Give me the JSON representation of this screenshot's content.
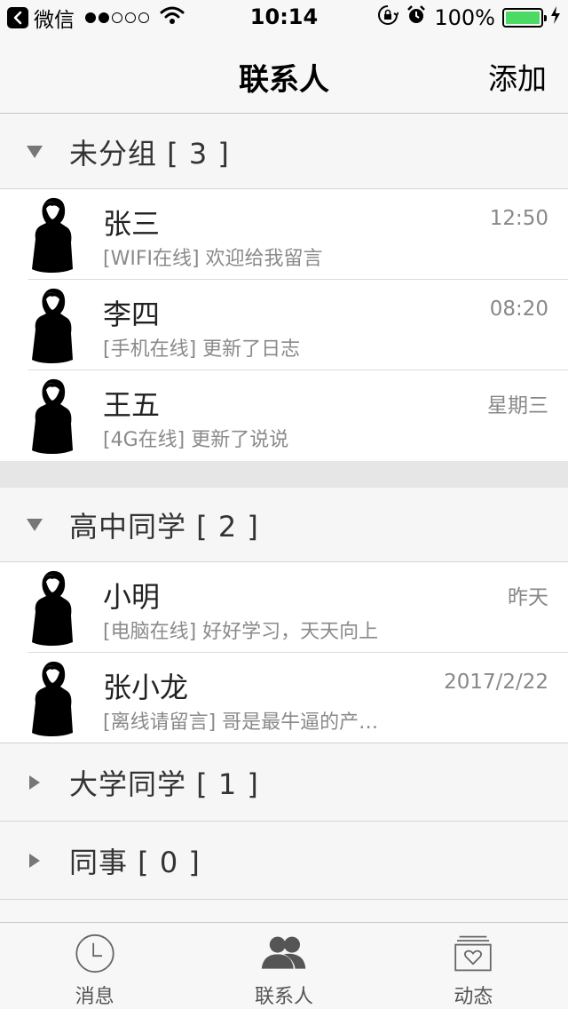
{
  "status_bar": {
    "back_app": "微信",
    "time": "10:14",
    "battery": "100%",
    "signal_bars_filled": 2,
    "signal_bars_total": 5
  },
  "nav": {
    "title": "联系人",
    "right_action": "添加"
  },
  "groups": [
    {
      "name": "未分组 [ 3 ]",
      "expanded": true,
      "contacts": [
        {
          "name": "张三",
          "status": "[WIFI在线] 欢迎给我留言",
          "time": "12:50"
        },
        {
          "name": "李四",
          "status": "[手机在线] 更新了日志",
          "time": "08:20"
        },
        {
          "name": "王五",
          "status": "[4G在线] 更新了说说",
          "time": "星期三"
        }
      ]
    },
    {
      "name": "高中同学 [ 2 ]",
      "expanded": true,
      "contacts": [
        {
          "name": "小明",
          "status": "[电脑在线] 好好学习，天天向上",
          "time": "昨天"
        },
        {
          "name": "张小龙",
          "status": "[离线请留言] 哥是最牛逼的产…",
          "time": "2017/2/22"
        }
      ]
    },
    {
      "name": "大学同学 [ 1 ]",
      "expanded": false
    },
    {
      "name": "同事 [ 0 ]",
      "expanded": false
    }
  ],
  "tabs": [
    {
      "label": "消息",
      "icon": "clock-icon"
    },
    {
      "label": "联系人",
      "icon": "contacts-icon"
    },
    {
      "label": "动态",
      "icon": "heart-card-icon"
    }
  ],
  "colors": {
    "battery_fill": "#4cd964",
    "background": "#f7f7f7",
    "secondary_text": "#8a8a8a"
  }
}
